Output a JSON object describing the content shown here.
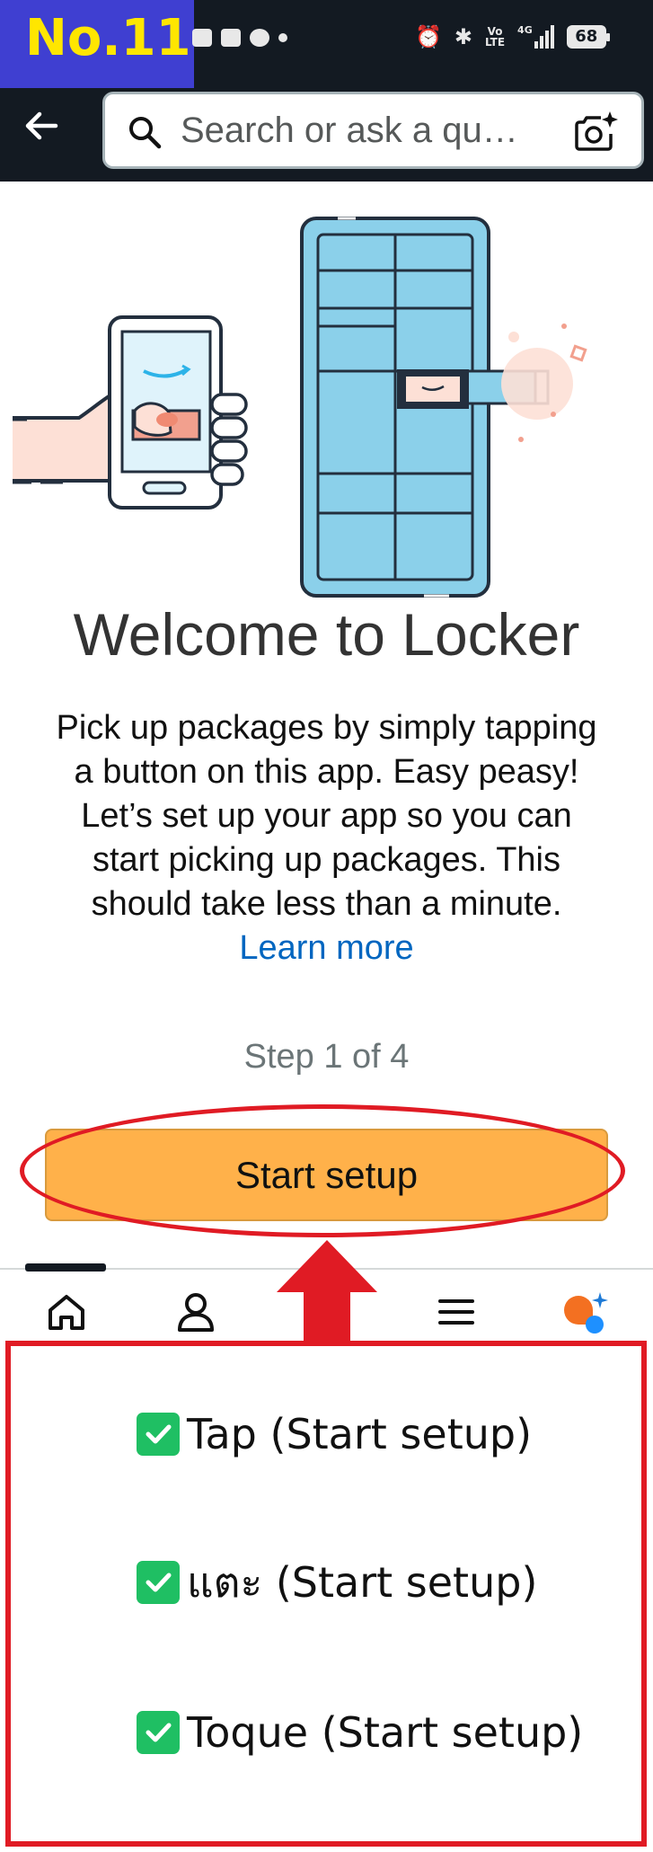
{
  "badge": {
    "label": "No.11"
  },
  "status_bar": {
    "battery": "68",
    "network_label": "Vo\nLTE",
    "signal_label": "4G"
  },
  "header": {
    "back_icon": "arrow-left-icon",
    "search_placeholder": "Search or ask a qu…",
    "search_icon": "magnifier-icon",
    "camera_icon": "camera-sparkle-icon"
  },
  "main": {
    "title": "Welcome to Locker",
    "description": "Pick up packages by simply tapping a button on this app. Easy peasy! Let’s set up your app so you can start picking up packages. This should take less than a minute.",
    "learn_more": "Learn more",
    "step": "Step 1 of 4",
    "start_button": "Start setup"
  },
  "bottom_nav": {
    "items": [
      "home-icon",
      "account-icon",
      "menu-icon",
      "assistant-icon"
    ]
  },
  "instructions": [
    {
      "text": "Tap (Start setup)"
    },
    {
      "text": "แตะ (Start setup)"
    },
    {
      "text": "Toque (Start setup)"
    }
  ],
  "colors": {
    "header_bg": "#131a22",
    "button": "#ffb14a",
    "link": "#0066c0",
    "annotation_red": "#e01b24",
    "check_green": "#1fbf63",
    "badge_bg": "#3f3fd1",
    "badge_text": "#ffe600"
  }
}
